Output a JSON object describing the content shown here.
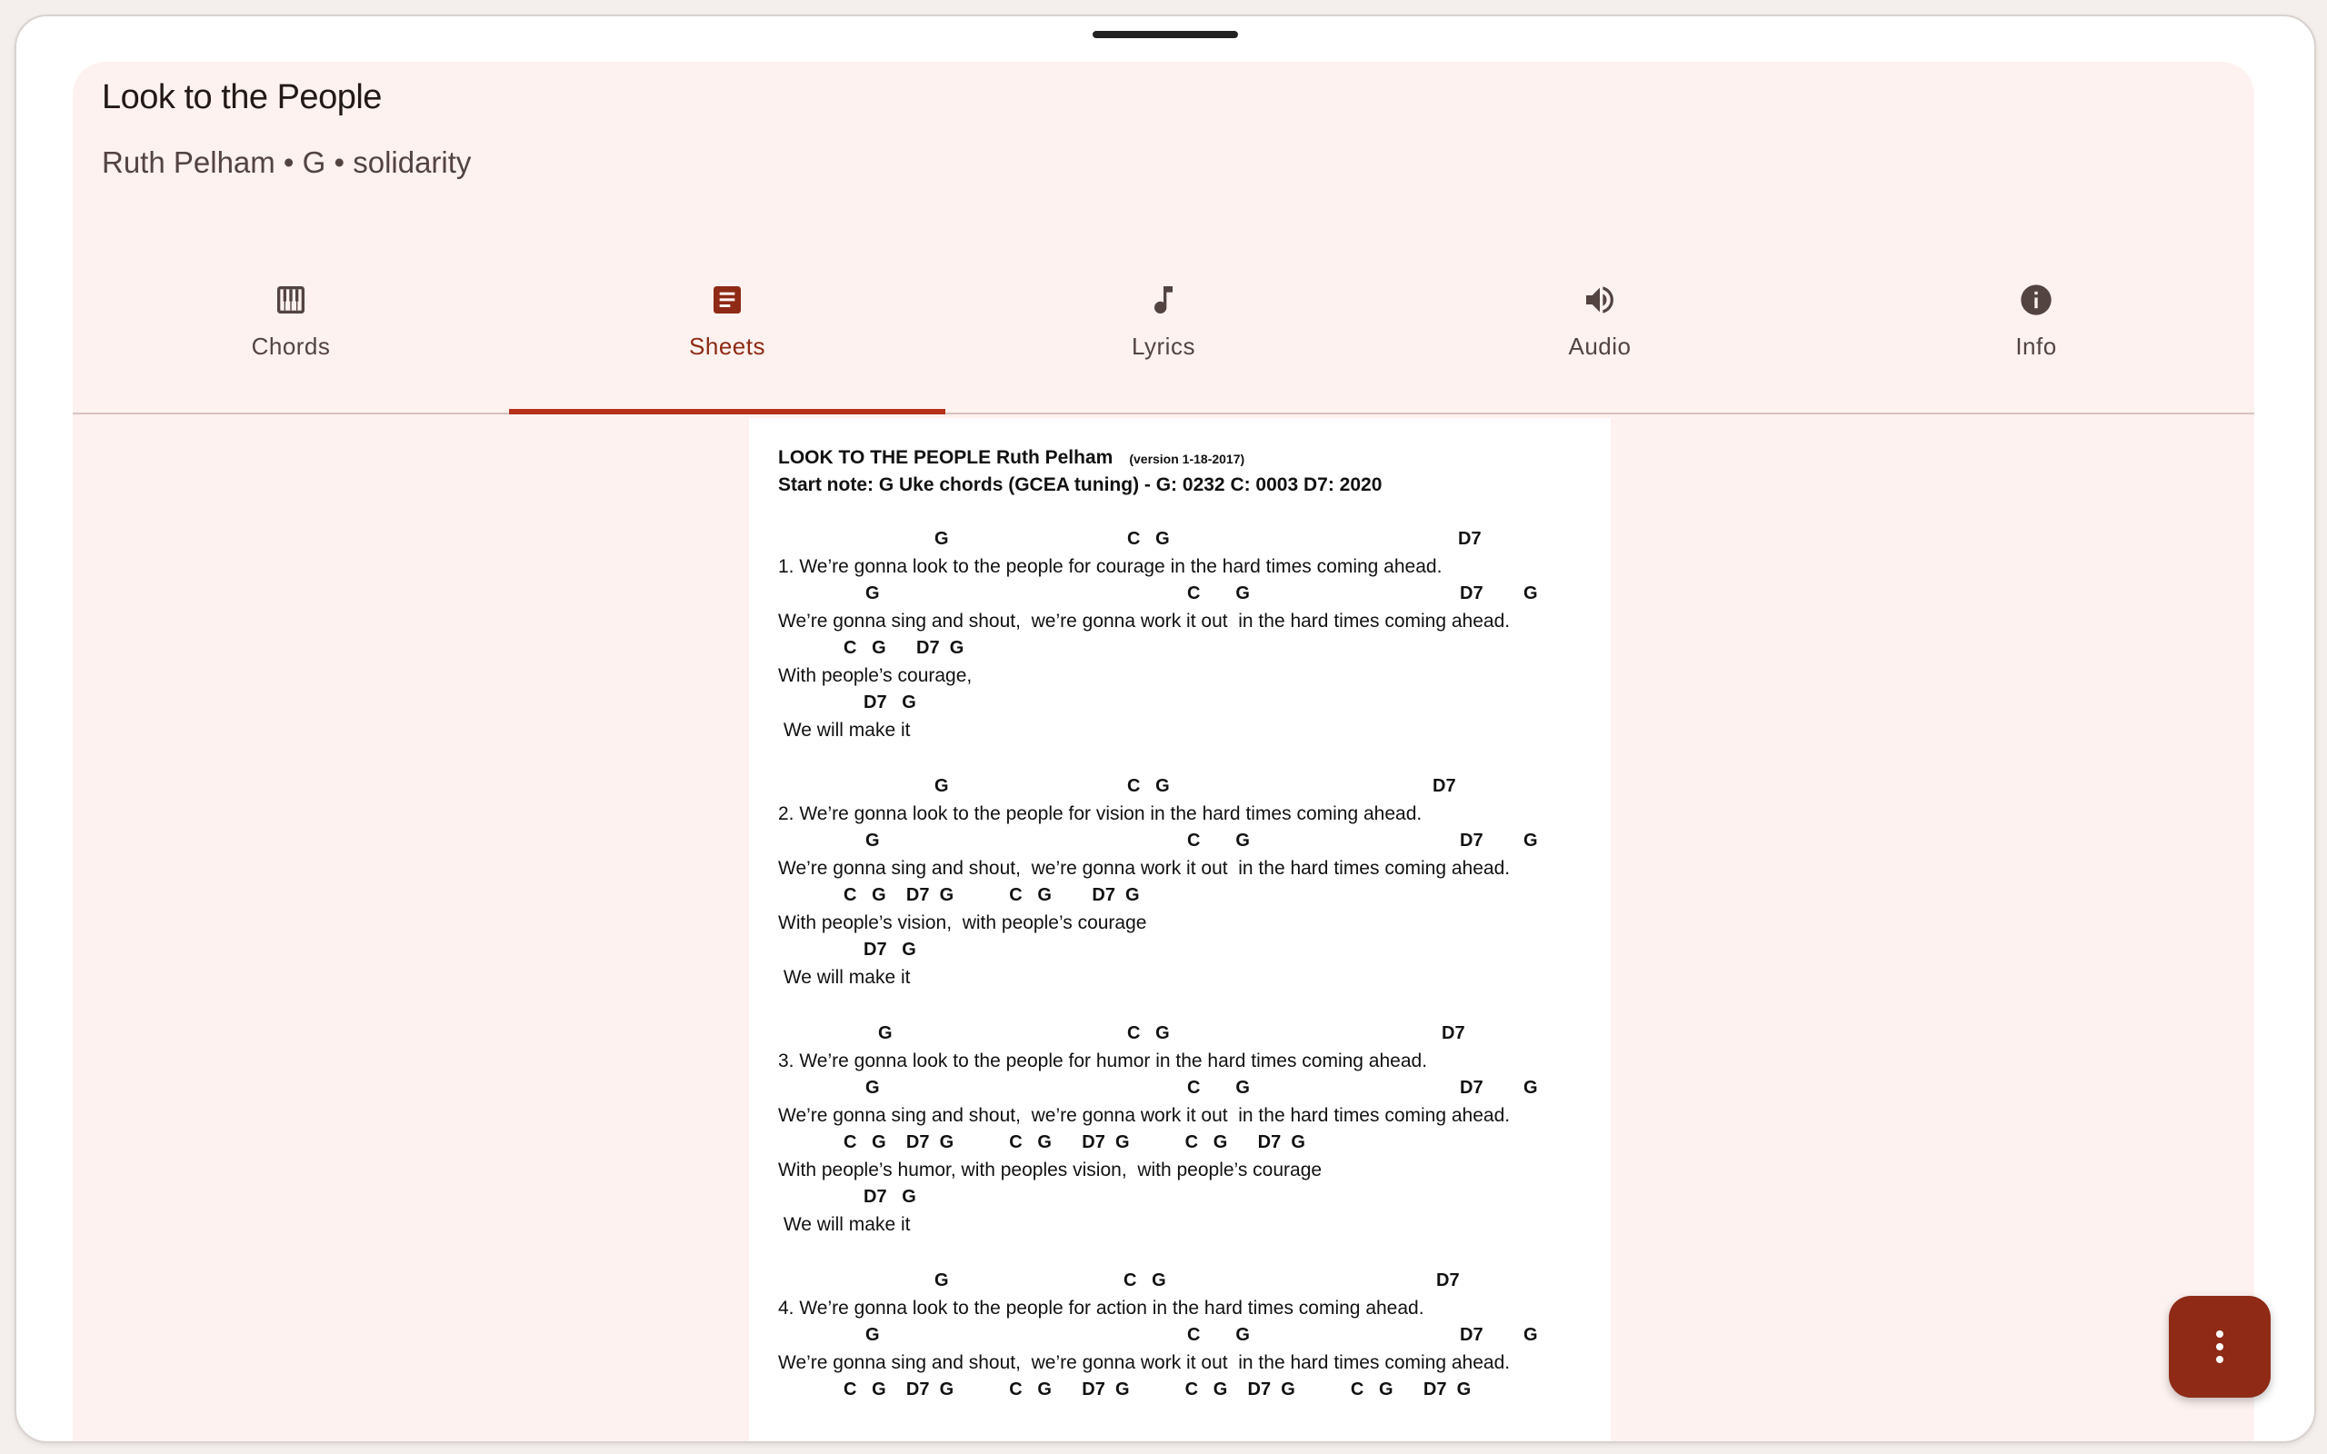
{
  "song": {
    "title": "Look to the People",
    "subtitle": "Ruth Pelham • G • solidarity"
  },
  "tabs": [
    {
      "label": "Chords",
      "icon": "piano-icon",
      "active": false
    },
    {
      "label": "Sheets",
      "icon": "article-icon",
      "active": true
    },
    {
      "label": "Lyrics",
      "icon": "music-note-icon",
      "active": false
    },
    {
      "label": "Audio",
      "icon": "volume-icon",
      "active": false
    },
    {
      "label": "Info",
      "icon": "info-icon",
      "active": false
    }
  ],
  "sheet": {
    "header_title": "LOOK TO THE PEOPLE  Ruth Pelham",
    "header_version": "(version 1-18-2017)",
    "header_line2": "Start note: G    Uke chords (GCEA tuning) -  G: 0232  C: 0003  D7: 2020",
    "verse1": {
      "c1": [
        "G",
        "C   G",
        "D7"
      ],
      "l1": "1. We’re gonna look to the people for courage in the hard times coming ahead.",
      "c2": [
        "G",
        "C       G",
        "D7        G"
      ],
      "l2": "We’re gonna sing and shout,  we’re gonna work it out  in the hard times coming ahead.",
      "c3": "C   G      D7  G",
      "l3": "With people’s courage,",
      "c4": "D7   G",
      "l4": " We will make it"
    },
    "verse2": {
      "c1": [
        "G",
        "C   G",
        "D7"
      ],
      "l1": "2. We’re gonna look to the people for vision in the hard times coming ahead.",
      "c2": [
        "G",
        "C       G",
        "D7        G"
      ],
      "l2": "We’re gonna sing and shout,  we’re gonna work it out  in the hard times coming ahead.",
      "c3": "C   G    D7  G           C   G        D7  G",
      "l3": "With people’s vision,  with people’s courage",
      "c4": "D7   G",
      "l4": " We will make it"
    },
    "verse3": {
      "c1": [
        "G",
        "C   G",
        "D7"
      ],
      "l1": "3. We’re gonna look to the people for humor in the hard times coming ahead.",
      "c2": [
        "G",
        "C       G",
        "D7        G"
      ],
      "l2": "We’re gonna sing and shout,  we’re gonna work it out  in the hard times coming ahead.",
      "c3": "C   G    D7  G           C   G      D7  G           C   G      D7  G",
      "l3": "With people’s humor, with peoples vision,  with people’s courage",
      "c4": "D7   G",
      "l4": " We will make it"
    },
    "verse4": {
      "c1": [
        "G",
        "C   G",
        "D7"
      ],
      "l1": "4. We’re gonna look to the people for action in the hard times coming ahead.",
      "c2": [
        "G",
        "C       G",
        "D7        G"
      ],
      "l2": "We’re gonna sing and shout,  we’re gonna work it out  in the hard times coming ahead.",
      "c3": "C   G    D7  G           C   G      D7  G           C   G    D7  G           C   G      D7  G"
    }
  },
  "fab": {
    "icon": "more-vert-icon"
  },
  "colors": {
    "accent": "#8e2a15",
    "surface": "#fdf2f0",
    "indicator": "#b5311a"
  }
}
